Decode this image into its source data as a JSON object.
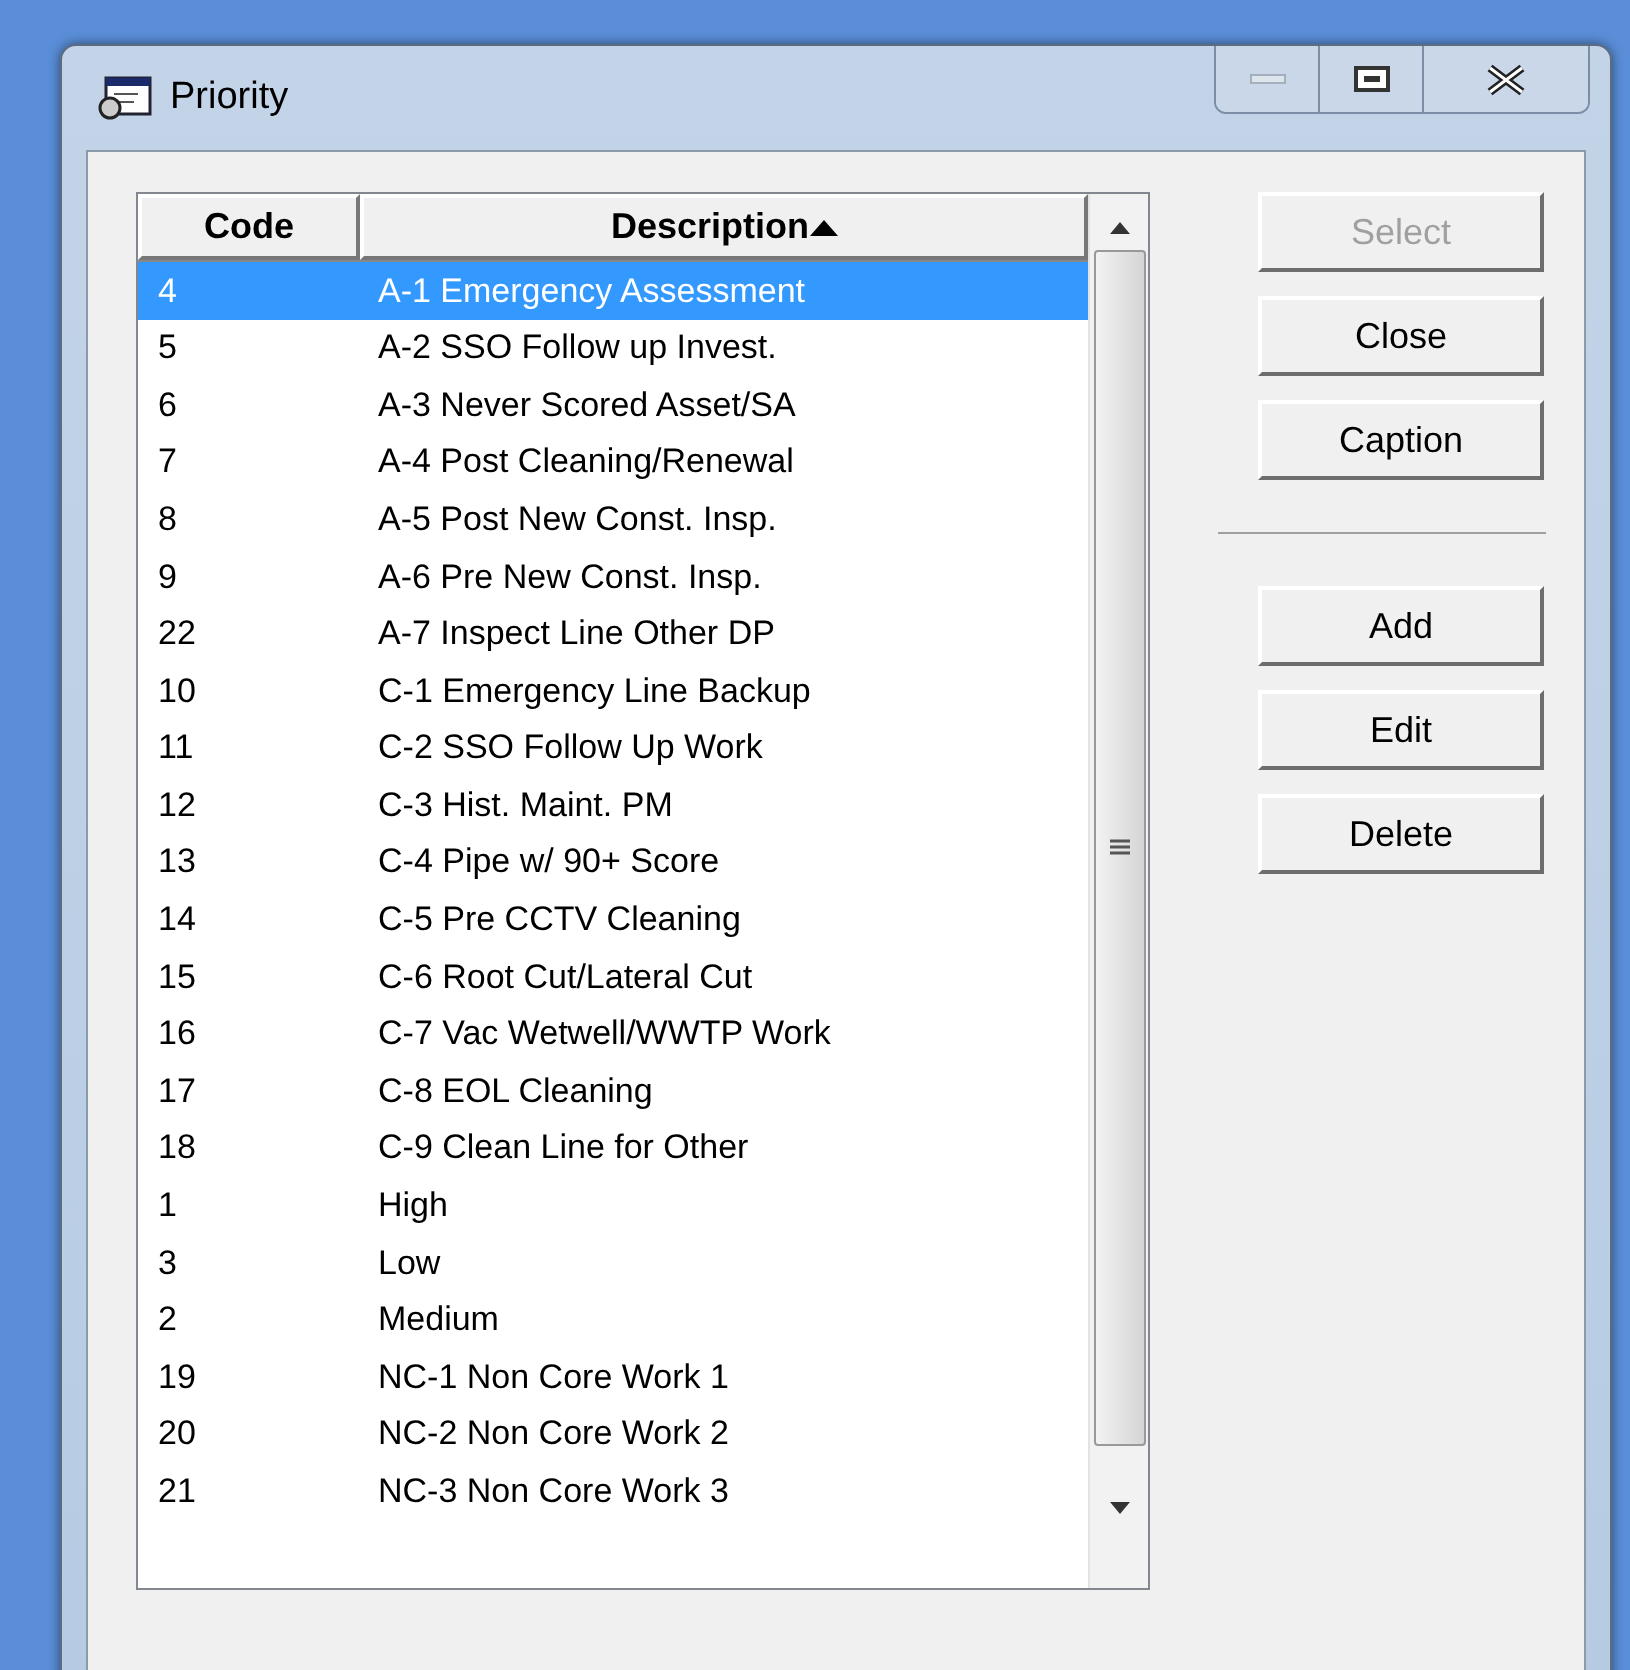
{
  "window": {
    "title": "Priority"
  },
  "table": {
    "columns": [
      {
        "label": "Code",
        "sorted": false
      },
      {
        "label": "Description",
        "sorted": true
      }
    ],
    "rows": [
      {
        "code": "4",
        "description": "A-1 Emergency Assessment",
        "selected": true
      },
      {
        "code": "5",
        "description": "A-2 SSO Follow up Invest.",
        "selected": false
      },
      {
        "code": "6",
        "description": "A-3 Never Scored Asset/SA",
        "selected": false
      },
      {
        "code": "7",
        "description": "A-4 Post Cleaning/Renewal",
        "selected": false
      },
      {
        "code": "8",
        "description": "A-5 Post New Const. Insp.",
        "selected": false
      },
      {
        "code": "9",
        "description": "A-6 Pre New Const. Insp.",
        "selected": false
      },
      {
        "code": "22",
        "description": "A-7 Inspect Line Other DP",
        "selected": false
      },
      {
        "code": "10",
        "description": "C-1 Emergency Line Backup",
        "selected": false
      },
      {
        "code": "11",
        "description": "C-2 SSO Follow Up Work",
        "selected": false
      },
      {
        "code": "12",
        "description": "C-3 Hist. Maint. PM",
        "selected": false
      },
      {
        "code": "13",
        "description": "C-4 Pipe w/ 90+ Score",
        "selected": false
      },
      {
        "code": "14",
        "description": "C-5 Pre CCTV Cleaning",
        "selected": false
      },
      {
        "code": "15",
        "description": "C-6 Root Cut/Lateral Cut",
        "selected": false
      },
      {
        "code": "16",
        "description": "C-7 Vac Wetwell/WWTP Work",
        "selected": false
      },
      {
        "code": "17",
        "description": "C-8 EOL Cleaning",
        "selected": false
      },
      {
        "code": "18",
        "description": "C-9 Clean Line for Other",
        "selected": false
      },
      {
        "code": "1",
        "description": "High",
        "selected": false
      },
      {
        "code": "3",
        "description": "Low",
        "selected": false
      },
      {
        "code": "2",
        "description": "Medium",
        "selected": false
      },
      {
        "code": "19",
        "description": "NC-1 Non Core Work 1",
        "selected": false
      },
      {
        "code": "20",
        "description": "NC-2 Non Core Work 2",
        "selected": false
      },
      {
        "code": "21",
        "description": "NC-3 Non Core Work 3",
        "selected": false
      }
    ]
  },
  "button_groups": [
    [
      {
        "label": "Select",
        "disabled": true
      },
      {
        "label": "Close",
        "disabled": false
      },
      {
        "label": "Caption",
        "disabled": false
      }
    ],
    [
      {
        "label": "Add",
        "disabled": false
      },
      {
        "label": "Edit",
        "disabled": false
      },
      {
        "label": "Delete",
        "disabled": false
      }
    ]
  ]
}
